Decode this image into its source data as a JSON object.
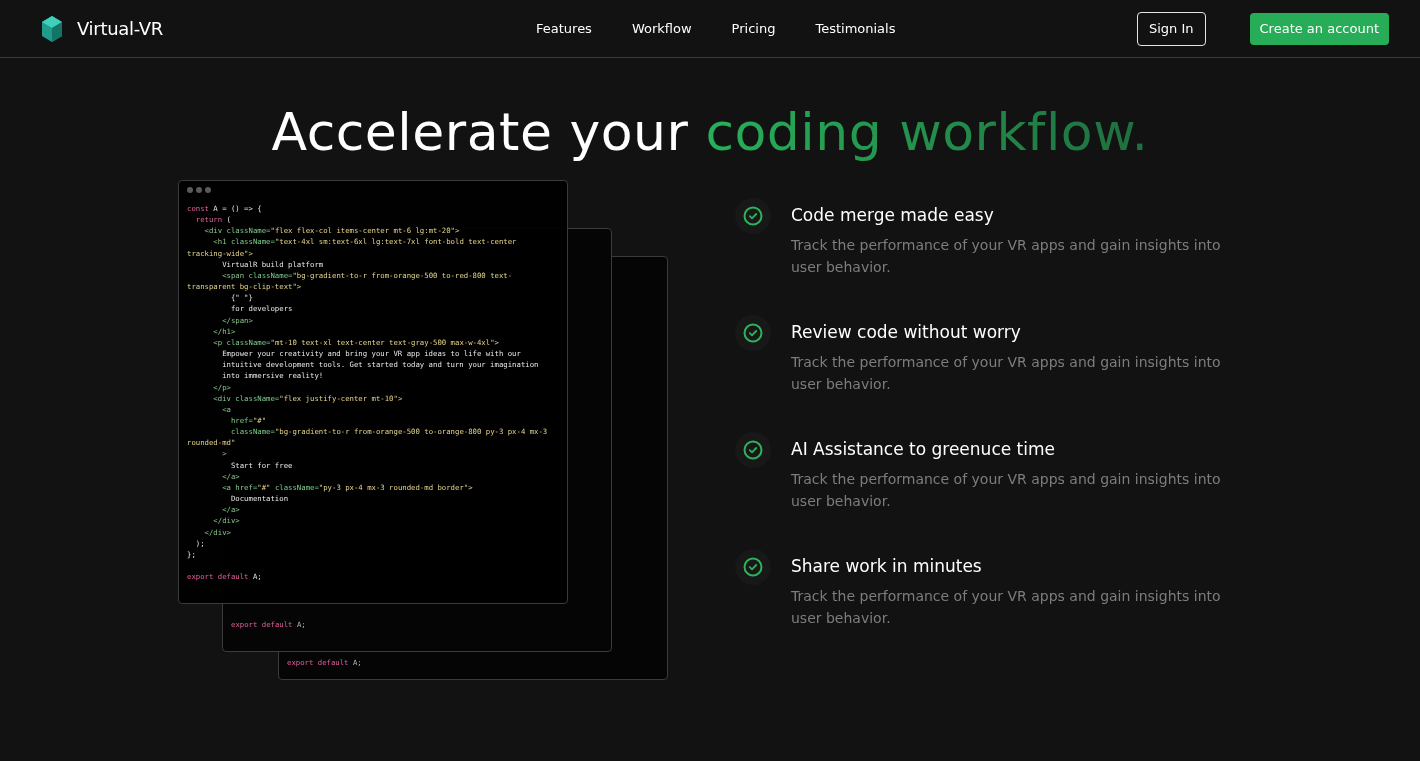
{
  "nav": {
    "brand": "Virtual-VR",
    "links": [
      "Features",
      "Workflow",
      "Pricing",
      "Testimonials"
    ],
    "buttons": [
      {
        "label": "Sign In",
        "kind": "outline"
      },
      {
        "label": "Create an account",
        "kind": "primary"
      }
    ]
  },
  "hero": {
    "title": "Accelerate your ",
    "title_accent": "coding workflow."
  },
  "code_windows": [
    {
      "lines": [
        [
          {
            "kind": "kw",
            "text": "export default "
          },
          {
            "kind": "text",
            "text": "A;"
          }
        ]
      ]
    },
    {
      "lines": [
        [
          {
            "kind": "kw",
            "text": "export default "
          },
          {
            "kind": "text",
            "text": "A;"
          }
        ]
      ]
    }
  ],
  "front_code": [
    [
      {
        "kind": "kw",
        "text": "const "
      },
      {
        "kind": "text",
        "text": "A = () => {"
      }
    ],
    [
      {
        "kind": "kw",
        "text": "  return "
      },
      {
        "kind": "text",
        "text": "("
      }
    ],
    [
      {
        "kind": "tag",
        "text": "    <div "
      },
      {
        "kind": "attr",
        "text": "className="
      },
      {
        "kind": "str",
        "text": "\"flex flex-col items-center mt-6 lg:mt-20\">"
      }
    ],
    [
      {
        "kind": "tag",
        "text": "      <h1 "
      },
      {
        "kind": "attr",
        "text": "className="
      },
      {
        "kind": "str",
        "text": "\"text-4xl sm:text-6xl lg:text-7xl font-bold text-center"
      }
    ],
    [
      {
        "kind": "str",
        "text": "tracking-wide\">"
      }
    ],
    [
      {
        "kind": "text",
        "text": "        VirtualR build platform"
      }
    ],
    [
      {
        "kind": "tag",
        "text": "        <span "
      },
      {
        "kind": "attr",
        "text": "className="
      },
      {
        "kind": "str",
        "text": "\"bg-gradient-to-r from-orange-500 to-red-800 text-"
      }
    ],
    [
      {
        "kind": "str",
        "text": "transparent bg-clip-text\">"
      }
    ],
    [
      {
        "kind": "text",
        "text": "          {\" \"}"
      }
    ],
    [
      {
        "kind": "text",
        "text": "          for developers"
      }
    ],
    [
      {
        "kind": "tag",
        "text": "        </span>"
      }
    ],
    [
      {
        "kind": "tag",
        "text": "      </h1>"
      }
    ],
    [
      {
        "kind": "tag",
        "text": "      <p "
      },
      {
        "kind": "attr",
        "text": "className="
      },
      {
        "kind": "str",
        "text": "\"mt-10 text-xl text-center text-gray-500 max-w-4xl\">"
      }
    ],
    [
      {
        "kind": "text",
        "text": "        Empower your creativity and bring your VR app ideas to life with our"
      }
    ],
    [
      {
        "kind": "text",
        "text": "        intuitive development tools. Get started today and turn your imagination"
      }
    ],
    [
      {
        "kind": "text",
        "text": "        into immersive reality!"
      }
    ],
    [
      {
        "kind": "tag",
        "text": "      </p>"
      }
    ],
    [
      {
        "kind": "tag",
        "text": "      <div "
      },
      {
        "kind": "attr",
        "text": "className="
      },
      {
        "kind": "str",
        "text": "\"flex justify-center mt-10\">"
      }
    ],
    [
      {
        "kind": "tag",
        "text": "        <a"
      }
    ],
    [
      {
        "kind": "attr",
        "text": "          href="
      },
      {
        "kind": "str",
        "text": "\"#\""
      }
    ],
    [
      {
        "kind": "attr",
        "text": "          className="
      },
      {
        "kind": "str",
        "text": "\"bg-gradient-to-r from-orange-500 to-orange-800 py-3 px-4 mx-3"
      }
    ],
    [
      {
        "kind": "str",
        "text": "rounded-md\""
      }
    ],
    [
      {
        "kind": "tag",
        "text": "        >"
      }
    ],
    [
      {
        "kind": "text",
        "text": "          Start for free"
      }
    ],
    [
      {
        "kind": "tag",
        "text": "        </a>"
      }
    ],
    [
      {
        "kind": "tag",
        "text": "        <a "
      },
      {
        "kind": "attr",
        "text": "href="
      },
      {
        "kind": "str",
        "text": "\"#\" "
      },
      {
        "kind": "attr",
        "text": "className="
      },
      {
        "kind": "str",
        "text": "\"py-3 px-4 mx-3 rounded-md border\">"
      }
    ],
    [
      {
        "kind": "text",
        "text": "          Documentation"
      }
    ],
    [
      {
        "kind": "tag",
        "text": "        </a>"
      }
    ],
    [
      {
        "kind": "tag",
        "text": "      </div>"
      }
    ],
    [
      {
        "kind": "tag",
        "text": "    </div>"
      }
    ],
    [
      {
        "kind": "text",
        "text": "  );"
      }
    ],
    [
      {
        "kind": "text",
        "text": "};"
      }
    ]
  ],
  "front_code_end": [
    {
      "kind": "kw",
      "text": "export default "
    },
    {
      "kind": "text",
      "text": "A;"
    }
  ],
  "features": [
    {
      "title": "Code merge made easy",
      "description": "Track the performance of your VR apps and gain insights into user behavior."
    },
    {
      "title": "Review code without worry",
      "description": "Track the performance of your VR apps and gain insights into user behavior."
    },
    {
      "title": "AI Assistance to greenuce time",
      "description": "Track the performance of your VR apps and gain insights into user behavior."
    },
    {
      "title": "Share work in minutes",
      "description": "Track the performance of your VR apps and gain insights into user behavior."
    }
  ]
}
